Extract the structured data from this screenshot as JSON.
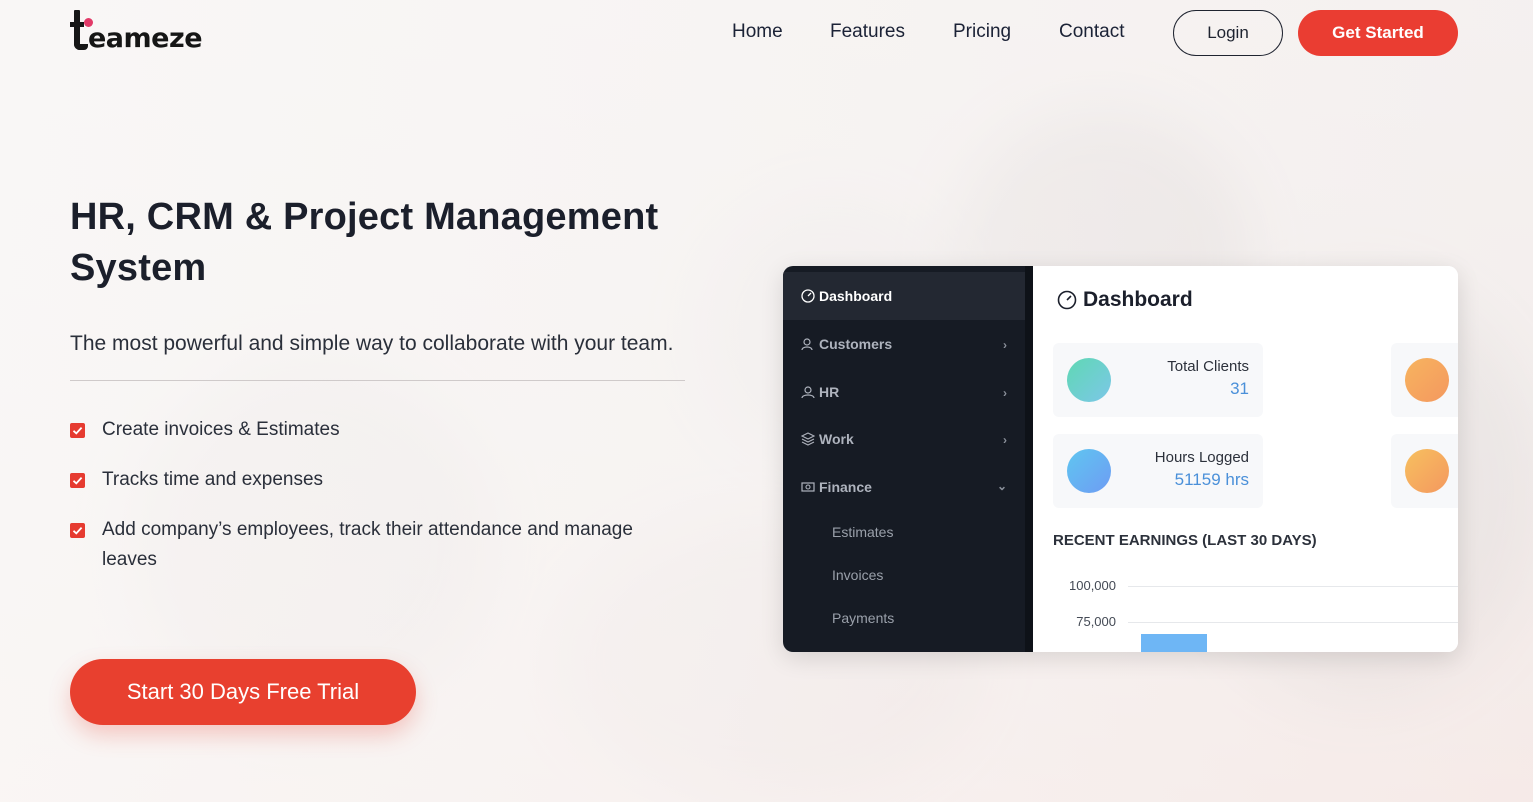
{
  "brand": {
    "logo_text": "eameze",
    "logo_full": "teameze",
    "accent": "#ea3d32",
    "logo_dot": "#e23a68"
  },
  "nav": {
    "home": "Home",
    "features": "Features",
    "pricing": "Pricing",
    "contact": "Contact",
    "login": "Login",
    "get_started": "Get Started"
  },
  "hero": {
    "title": "HR, CRM & Project Management System",
    "subtitle": "The most powerful and simple way to collaborate with your team.",
    "features": [
      "Create invoices & Estimates",
      "Tracks time and expenses",
      "Add company’s employees, track their attendance and manage leaves"
    ],
    "cta": "Start 30 Days Free Trial"
  },
  "mockup": {
    "sidebar": {
      "items": [
        {
          "label": "Dashboard",
          "icon": "speedometer-icon"
        },
        {
          "label": "Customers",
          "icon": "users-icon"
        },
        {
          "label": "HR",
          "icon": "user-icon"
        },
        {
          "label": "Work",
          "icon": "layers-icon"
        },
        {
          "label": "Finance",
          "icon": "money-icon"
        }
      ],
      "subitems": [
        "Estimates",
        "Invoices",
        "Payments"
      ]
    },
    "title": "Dashboard",
    "cards": [
      {
        "label": "Total Clients",
        "value": "31"
      },
      {
        "label": "Hours Logged",
        "value": "51159 hrs"
      }
    ],
    "earnings_title": "RECENT EARNINGS (LAST 30 DAYS)",
    "y_ticks": [
      "100,000",
      "75,000"
    ]
  }
}
